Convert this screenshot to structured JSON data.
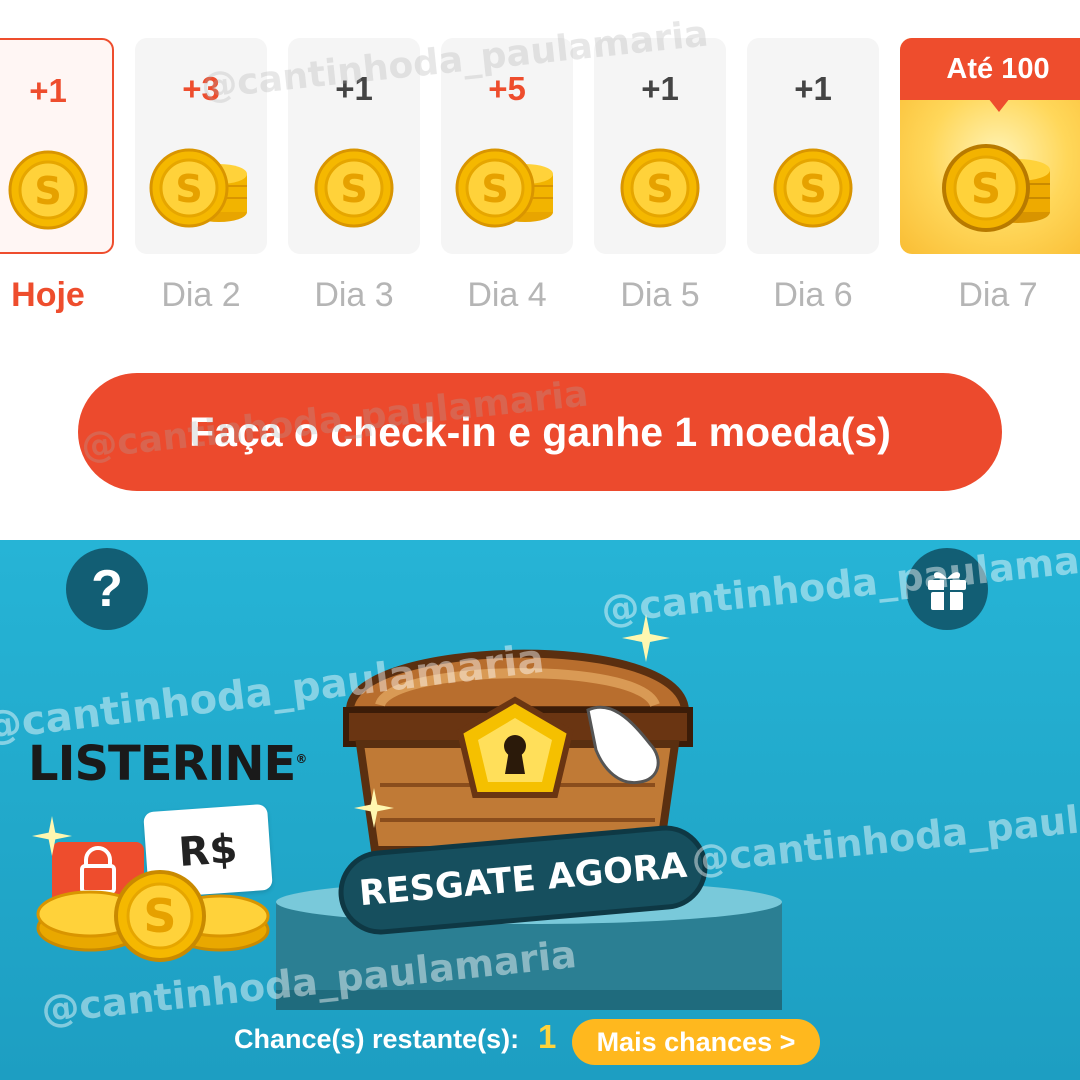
{
  "checkin": {
    "days": [
      {
        "amount": "+1",
        "label": "Hoje",
        "highlight": true
      },
      {
        "amount": "+3",
        "label": "Dia 2",
        "highlight": false
      },
      {
        "amount": "+1",
        "label": "Dia 3",
        "highlight": false
      },
      {
        "amount": "+5",
        "label": "Dia 4",
        "highlight": false
      },
      {
        "amount": "+1",
        "label": "Dia 5",
        "highlight": false
      },
      {
        "amount": "+1",
        "label": "Dia 6",
        "highlight": false
      },
      {
        "amount": "Até 100",
        "label": "Dia 7",
        "highlight": false
      }
    ],
    "button_label": "Faça o check-in e ganhe 1 moeda(s)",
    "accent_color": "#ee4d2d"
  },
  "game": {
    "help_icon": "?",
    "gift_icon": "gift-icon",
    "sponsor": "LISTERINE",
    "sponsor_mark": "®",
    "currency_card": "R$",
    "claim_label": "RESGATE AGORA",
    "chances_label": "Chance(s) restante(s):",
    "chances_count": "1",
    "more_chances_label": "Mais chances >",
    "background_color": "#22aacb"
  },
  "watermark": "@cantinhoda_paulamaria"
}
